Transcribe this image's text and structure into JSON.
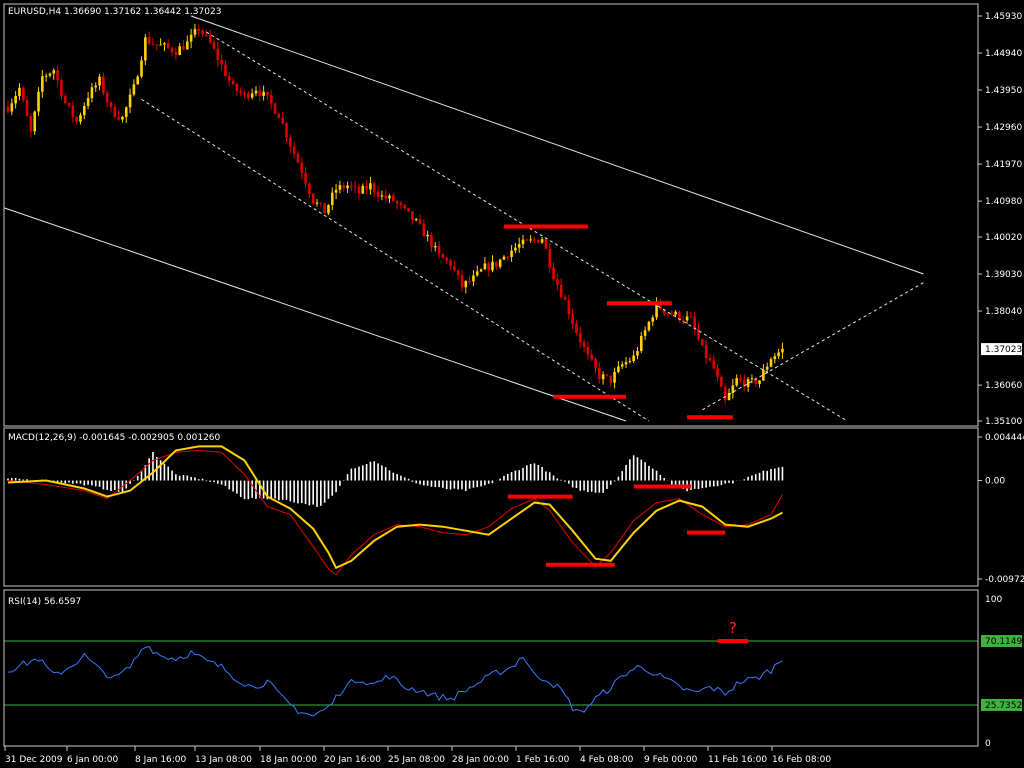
{
  "chart_data": {
    "type": "candlestick",
    "symbol": "EURUSD,H4",
    "ohlc_header": "EURUSD,H4  1.36690 1.37162 1.36442 1.37023",
    "last_price_label": "1.37023",
    "x_ticks": [
      "31 Dec 2009",
      "6 Jan 00:00",
      "8 Jan 16:00",
      "13 Jan 08:00",
      "18 Jan 00:00",
      "20 Jan 16:00",
      "25 Jan 08:00",
      "28 Jan 00:00",
      "1 Feb 16:00",
      "4 Feb 08:00",
      "9 Feb 00:00",
      "11 Feb 16:00",
      "16 Feb 08:00"
    ],
    "price_ticks": [
      "1.45930",
      "1.44940",
      "1.43950",
      "1.42960",
      "1.41970",
      "1.40980",
      "1.40020",
      "1.39030",
      "1.38040",
      "1.37023",
      "1.36060",
      "1.35100"
    ],
    "price_range": [
      1.351,
      1.4593
    ],
    "price_path": [
      [
        0,
        1.435
      ],
      [
        3,
        1.44
      ],
      [
        6,
        1.428
      ],
      [
        9,
        1.443
      ],
      [
        12,
        1.445
      ],
      [
        15,
        1.436
      ],
      [
        18,
        1.431
      ],
      [
        21,
        1.438
      ],
      [
        24,
        1.442
      ],
      [
        27,
        1.434
      ],
      [
        30,
        1.432
      ],
      [
        33,
        1.44
      ],
      [
        36,
        1.453
      ],
      [
        38,
        1.452
      ],
      [
        41,
        1.451
      ],
      [
        44,
        1.45
      ],
      [
        47,
        1.452
      ],
      [
        50,
        1.456
      ],
      [
        53,
        1.452
      ],
      [
        56,
        1.446
      ],
      [
        59,
        1.44
      ],
      [
        62,
        1.438
      ],
      [
        65,
        1.44
      ],
      [
        68,
        1.437
      ],
      [
        71,
        1.433
      ],
      [
        74,
        1.425
      ],
      [
        77,
        1.418
      ],
      [
        80,
        1.41
      ],
      [
        83,
        1.407
      ],
      [
        86,
        1.413
      ],
      [
        89,
        1.414
      ],
      [
        92,
        1.412
      ],
      [
        95,
        1.414
      ],
      [
        98,
        1.411
      ],
      [
        101,
        1.41
      ],
      [
        104,
        1.407
      ],
      [
        107,
        1.404
      ],
      [
        110,
        1.4
      ],
      [
        113,
        1.395
      ],
      [
        116,
        1.393
      ],
      [
        119,
        1.387
      ],
      [
        122,
        1.389
      ],
      [
        125,
        1.392
      ],
      [
        128,
        1.393
      ],
      [
        131,
        1.396
      ],
      [
        134,
        1.398
      ],
      [
        137,
        1.399
      ],
      [
        140,
        1.4
      ],
      [
        143,
        1.39
      ],
      [
        146,
        1.383
      ],
      [
        149,
        1.375
      ],
      [
        152,
        1.368
      ],
      [
        155,
        1.363
      ],
      [
        158,
        1.362
      ],
      [
        161,
        1.366
      ],
      [
        164,
        1.368
      ],
      [
        167,
        1.375
      ],
      [
        170,
        1.382
      ],
      [
        173,
        1.38
      ],
      [
        176,
        1.379
      ],
      [
        179,
        1.378
      ],
      [
        182,
        1.37
      ],
      [
        185,
        1.365
      ],
      [
        188,
        1.356
      ],
      [
        191,
        1.362
      ],
      [
        194,
        1.361
      ],
      [
        197,
        1.362
      ],
      [
        200,
        1.368
      ],
      [
        203,
        1.37
      ]
    ],
    "candle_count": 204,
    "trendlines": [
      {
        "style": "solid",
        "from": [
          48,
          1.4593
        ],
        "to": [
          240,
          1.3903
        ]
      },
      {
        "style": "solid",
        "from": [
          -1,
          1.408
        ],
        "to": [
          162,
          1.351
        ]
      },
      {
        "style": "dashed",
        "from": [
          52,
          1.455
        ],
        "to": [
          220,
          1.351
        ]
      },
      {
        "style": "dashed",
        "from": [
          35,
          1.437
        ],
        "to": [
          168,
          1.351
        ]
      },
      {
        "style": "dashed",
        "from": [
          182,
          1.354
        ],
        "to": [
          240,
          1.388
        ]
      }
    ],
    "price_marks": [
      {
        "from": 130,
        "to": 152,
        "value": 1.403
      },
      {
        "from": 157,
        "to": 174,
        "value": 1.3825
      },
      {
        "from": 143,
        "to": 162,
        "value": 1.3575
      },
      {
        "from": 178,
        "to": 190,
        "value": 1.352
      }
    ],
    "macd": {
      "label": "MACD(12,26,9) -0.001645 -0.002905 0.001260",
      "ticks": [
        "0.004444",
        "0.00",
        "-0.009723"
      ],
      "range": [
        -0.00972,
        0.00444
      ],
      "hist_path": [
        [
          0,
          0.0002
        ],
        [
          10,
          0.0
        ],
        [
          20,
          -0.0004
        ],
        [
          30,
          -0.0012
        ],
        [
          34,
          0.0004
        ],
        [
          38,
          0.0028
        ],
        [
          44,
          0.0006
        ],
        [
          50,
          0.0002
        ],
        [
          56,
          -0.0004
        ],
        [
          62,
          -0.0018
        ],
        [
          70,
          -0.0018
        ],
        [
          76,
          -0.0022
        ],
        [
          82,
          -0.0026
        ],
        [
          86,
          -0.0012
        ],
        [
          90,
          0.0012
        ],
        [
          96,
          0.002
        ],
        [
          102,
          0.0006
        ],
        [
          108,
          -0.0004
        ],
        [
          114,
          -0.0008
        ],
        [
          120,
          -0.001
        ],
        [
          126,
          -0.0004
        ],
        [
          132,
          0.0008
        ],
        [
          138,
          0.0018
        ],
        [
          144,
          0.0002
        ],
        [
          150,
          -0.001
        ],
        [
          156,
          -0.0012
        ],
        [
          160,
          0.0004
        ],
        [
          164,
          0.0026
        ],
        [
          170,
          0.001
        ],
        [
          174,
          -0.0004
        ],
        [
          178,
          -0.001
        ],
        [
          184,
          -0.0006
        ],
        [
          190,
          -0.0002
        ],
        [
          196,
          0.0006
        ],
        [
          200,
          0.0012
        ],
        [
          203,
          0.0014
        ]
      ],
      "signal_path": [
        [
          0,
          -0.0002
        ],
        [
          10,
          0.0
        ],
        [
          20,
          -0.0008
        ],
        [
          26,
          -0.0016
        ],
        [
          32,
          -0.001
        ],
        [
          38,
          0.0008
        ],
        [
          44,
          0.003
        ],
        [
          50,
          0.0034
        ],
        [
          56,
          0.0034
        ],
        [
          62,
          0.002
        ],
        [
          68,
          -0.0016
        ],
        [
          74,
          -0.0028
        ],
        [
          80,
          -0.0048
        ],
        [
          84,
          -0.0072
        ],
        [
          86,
          -0.0087
        ],
        [
          90,
          -0.008
        ],
        [
          96,
          -0.006
        ],
        [
          102,
          -0.0046
        ],
        [
          108,
          -0.0044
        ],
        [
          114,
          -0.0046
        ],
        [
          120,
          -0.005
        ],
        [
          126,
          -0.0054
        ],
        [
          132,
          -0.0038
        ],
        [
          138,
          -0.0022
        ],
        [
          142,
          -0.0024
        ],
        [
          148,
          -0.005
        ],
        [
          154,
          -0.0078
        ],
        [
          158,
          -0.008
        ],
        [
          164,
          -0.0052
        ],
        [
          170,
          -0.003
        ],
        [
          176,
          -0.002
        ],
        [
          182,
          -0.0026
        ],
        [
          188,
          -0.0044
        ],
        [
          194,
          -0.0046
        ],
        [
          200,
          -0.0038
        ],
        [
          203,
          -0.0032
        ]
      ],
      "macd_path": [
        [
          0,
          0.0
        ],
        [
          10,
          -0.0004
        ],
        [
          20,
          -0.001
        ],
        [
          26,
          -0.0018
        ],
        [
          32,
          0.0
        ],
        [
          38,
          0.002
        ],
        [
          44,
          0.0028
        ],
        [
          50,
          0.003
        ],
        [
          56,
          0.0028
        ],
        [
          62,
          0.0006
        ],
        [
          68,
          -0.0026
        ],
        [
          74,
          -0.0034
        ],
        [
          80,
          -0.0066
        ],
        [
          84,
          -0.0088
        ],
        [
          86,
          -0.0094
        ],
        [
          90,
          -0.0074
        ],
        [
          96,
          -0.0054
        ],
        [
          102,
          -0.0044
        ],
        [
          108,
          -0.0046
        ],
        [
          114,
          -0.0052
        ],
        [
          120,
          -0.0054
        ],
        [
          126,
          -0.0046
        ],
        [
          132,
          -0.0028
        ],
        [
          138,
          -0.0018
        ],
        [
          142,
          -0.003
        ],
        [
          148,
          -0.0062
        ],
        [
          154,
          -0.0086
        ],
        [
          158,
          -0.0072
        ],
        [
          164,
          -0.004
        ],
        [
          170,
          -0.0022
        ],
        [
          176,
          -0.0018
        ],
        [
          182,
          -0.0034
        ],
        [
          188,
          -0.0046
        ],
        [
          194,
          -0.0044
        ],
        [
          200,
          -0.0034
        ],
        [
          203,
          -0.0014
        ]
      ],
      "marks": [
        {
          "from": 131,
          "to": 148,
          "value": -0.0016
        },
        {
          "from": 141,
          "to": 159,
          "value": -0.0084
        },
        {
          "from": 164,
          "to": 179,
          "value": -0.0006
        },
        {
          "from": 178,
          "to": 188,
          "value": -0.0052
        }
      ]
    },
    "rsi": {
      "label": "RSI(14) 56.6597",
      "ticks": [
        "100",
        "70.1149",
        "25.7352",
        "0"
      ],
      "levels": [
        70.1149,
        25.7352
      ],
      "range": [
        0,
        100
      ],
      "path": [
        [
          0,
          50
        ],
        [
          4,
          54
        ],
        [
          8,
          58
        ],
        [
          12,
          46
        ],
        [
          16,
          52
        ],
        [
          20,
          60
        ],
        [
          24,
          50
        ],
        [
          28,
          44
        ],
        [
          32,
          52
        ],
        [
          36,
          68
        ],
        [
          40,
          60
        ],
        [
          44,
          58
        ],
        [
          48,
          62
        ],
        [
          52,
          56
        ],
        [
          56,
          52
        ],
        [
          60,
          44
        ],
        [
          64,
          38
        ],
        [
          68,
          42
        ],
        [
          72,
          30
        ],
        [
          76,
          22
        ],
        [
          80,
          18
        ],
        [
          84,
          24
        ],
        [
          88,
          38
        ],
        [
          92,
          44
        ],
        [
          96,
          40
        ],
        [
          100,
          46
        ],
        [
          104,
          38
        ],
        [
          108,
          36
        ],
        [
          112,
          32
        ],
        [
          116,
          30
        ],
        [
          120,
          36
        ],
        [
          124,
          42
        ],
        [
          128,
          48
        ],
        [
          132,
          52
        ],
        [
          135,
          60
        ],
        [
          138,
          46
        ],
        [
          141,
          44
        ],
        [
          145,
          36
        ],
        [
          148,
          24
        ],
        [
          150,
          20
        ],
        [
          154,
          30
        ],
        [
          158,
          38
        ],
        [
          162,
          48
        ],
        [
          165,
          52
        ],
        [
          168,
          50
        ],
        [
          172,
          44
        ],
        [
          176,
          38
        ],
        [
          180,
          34
        ],
        [
          184,
          38
        ],
        [
          188,
          34
        ],
        [
          192,
          42
        ],
        [
          196,
          44
        ],
        [
          200,
          50
        ],
        [
          203,
          58
        ]
      ],
      "mark": {
        "from": 186,
        "to": 194,
        "value": 70.1149,
        "text": "?"
      }
    }
  }
}
